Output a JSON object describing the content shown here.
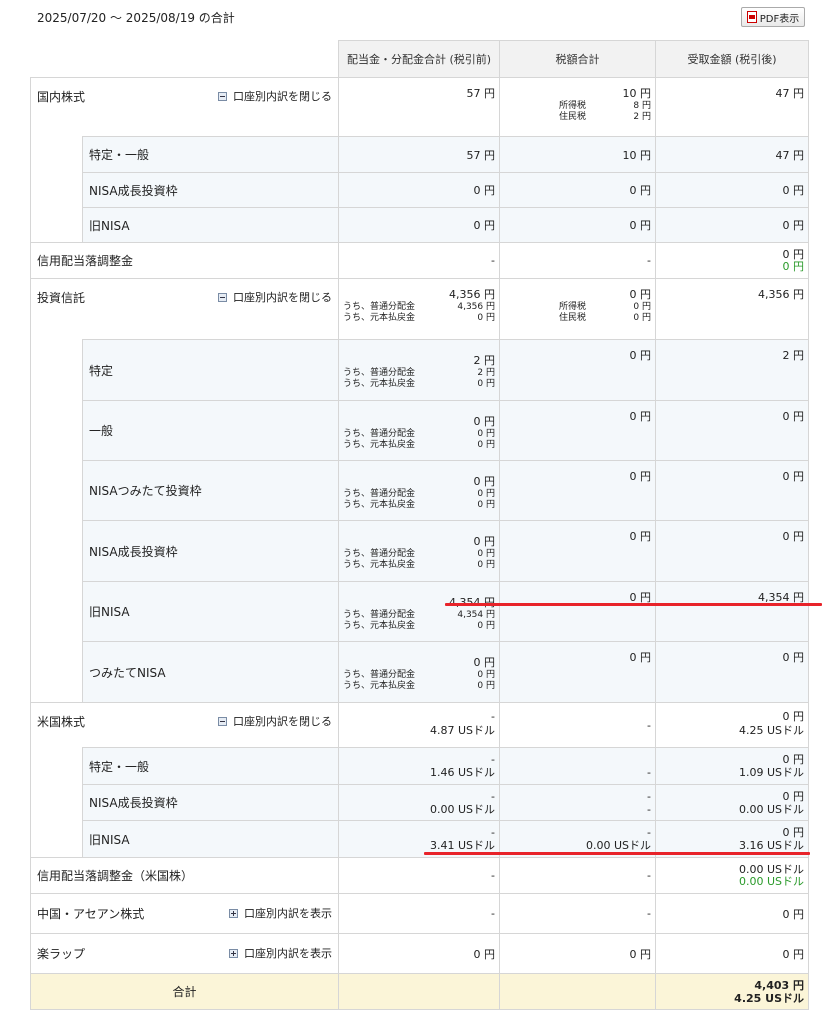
{
  "period": "2025/07/20 〜 2025/08/19 の合計",
  "pdf_button": "PDF表示",
  "headers": [
    "配当金・分配金合計 (税引前)",
    "税額合計",
    "受取金額 (税引後)"
  ],
  "domestic": {
    "label": "国内株式",
    "toggle": "口座別内訳を閉じる",
    "pretax": "57 円",
    "tax": "10 円",
    "tax_items": [
      [
        "所得税",
        "8 円"
      ],
      [
        "住民税",
        "2 円"
      ]
    ],
    "net": "47 円",
    "rows": [
      {
        "label": "特定・一般",
        "pretax": "57 円",
        "tax": "10 円",
        "net": "47 円"
      },
      {
        "label": "NISA成長投資枠",
        "pretax": "0 円",
        "tax": "0 円",
        "net": "0 円"
      },
      {
        "label": "旧NISA",
        "pretax": "0 円",
        "tax": "0 円",
        "net": "0 円"
      }
    ]
  },
  "margin_adj": {
    "label": "信用配当落調整金",
    "pretax": "-",
    "tax": "-",
    "net": "0 円",
    "net2": "0 円"
  },
  "fund": {
    "label": "投資信託",
    "toggle": "口座別内訳を閉じる",
    "pretax": "4,356 円",
    "tax": "0 円",
    "tax_items": [
      [
        "所得税",
        "0 円"
      ],
      [
        "住民税",
        "0 円"
      ]
    ],
    "net": "4,356 円",
    "brk_labels": [
      "うち、普通分配金",
      "うち、元本払戻金"
    ],
    "brk_values": [
      "4,356 円",
      "0 円"
    ],
    "rows": [
      {
        "label": "特定",
        "pretax": "2 円",
        "b1": "2 円",
        "b2": "0 円",
        "tax": "0 円",
        "net": "2 円"
      },
      {
        "label": "一般",
        "pretax": "0 円",
        "b1": "0 円",
        "b2": "0 円",
        "tax": "0 円",
        "net": "0 円"
      },
      {
        "label": "NISAつみたて投資枠",
        "pretax": "0 円",
        "b1": "0 円",
        "b2": "0 円",
        "tax": "0 円",
        "net": "0 円"
      },
      {
        "label": "NISA成長投資枠",
        "pretax": "0 円",
        "b1": "0 円",
        "b2": "0 円",
        "tax": "0 円",
        "net": "0 円"
      },
      {
        "label": "旧NISA",
        "pretax": "4,354 円",
        "b1": "4,354 円",
        "b2": "0 円",
        "tax": "0 円",
        "net": "4,354 円"
      },
      {
        "label": "つみたてNISA",
        "pretax": "0 円",
        "b1": "0 円",
        "b2": "0 円",
        "tax": "0 円",
        "net": "0 円"
      }
    ]
  },
  "us": {
    "label": "米国株式",
    "toggle": "口座別内訳を閉じる",
    "pretax1": "-",
    "pretax2": "4.87 USドル",
    "tax": "-",
    "net1": "0 円",
    "net2": "4.25 USドル",
    "rows": [
      {
        "label": "特定・一般",
        "pretax1": "-",
        "pretax2": "1.46 USドル",
        "tax1": "",
        "tax2": "-",
        "net1": "0 円",
        "net2": "1.09 USドル"
      },
      {
        "label": "NISA成長投資枠",
        "pretax1": "-",
        "pretax2": "0.00 USドル",
        "tax1": "-",
        "tax2": "-",
        "net1": "0 円",
        "net2": "0.00 USドル"
      },
      {
        "label": "旧NISA",
        "pretax1": "-",
        "pretax2": "3.41 USドル",
        "tax1": "-",
        "tax2": "0.00 USドル",
        "net1": "0 円",
        "net2": "3.16 USドル"
      }
    ]
  },
  "margin_adj_us": {
    "label": "信用配当落調整金（米国株）",
    "pretax": "-",
    "tax": "-",
    "net": "0.00 USドル",
    "net2": "0.00 USドル"
  },
  "china": {
    "label": "中国・アセアン株式",
    "toggle": "口座別内訳を表示",
    "pretax": "-",
    "tax": "-",
    "net": "0 円"
  },
  "wrap": {
    "label": "楽ラップ",
    "toggle": "口座別内訳を表示",
    "pretax": "0 円",
    "tax": "0 円",
    "net": "0 円"
  },
  "total": {
    "label": "合計",
    "net1": "4,403 円",
    "net2": "4.25 USドル"
  },
  "colors": {
    "highlight_line": "#e8232a",
    "green": "#2a9a2a"
  }
}
